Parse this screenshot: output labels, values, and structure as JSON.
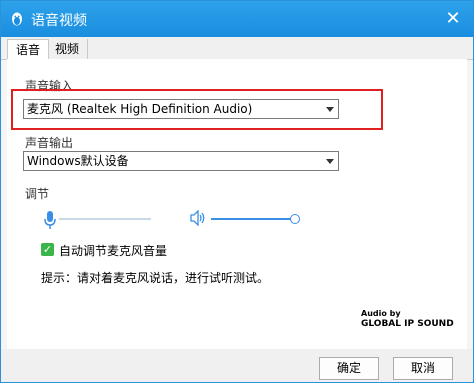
{
  "window": {
    "title": "语音视频"
  },
  "tabs": [
    {
      "label": "语音"
    },
    {
      "label": "视频"
    }
  ],
  "input": {
    "label": "声音输入",
    "selected": "麦克风 (Realtek High Definition Audio)"
  },
  "output": {
    "label": "声音输出",
    "selected": "Windows默认设备"
  },
  "adjust": {
    "label": "调节",
    "mic_level": 0.0,
    "speaker_level": 1.0
  },
  "auto_adjust": {
    "label": "自动调节麦克风音量",
    "checked": true
  },
  "hint": "提示：请对着麦克风说话，进行试听测试。",
  "logo": {
    "small": "Audio by",
    "main": "GLOBAL IP SOUND"
  },
  "buttons": {
    "ok": "确定",
    "cancel": "取消"
  },
  "colors": {
    "titlebar": "#1a8ddf",
    "highlight": "#e02020",
    "check": "#3ab54a"
  }
}
